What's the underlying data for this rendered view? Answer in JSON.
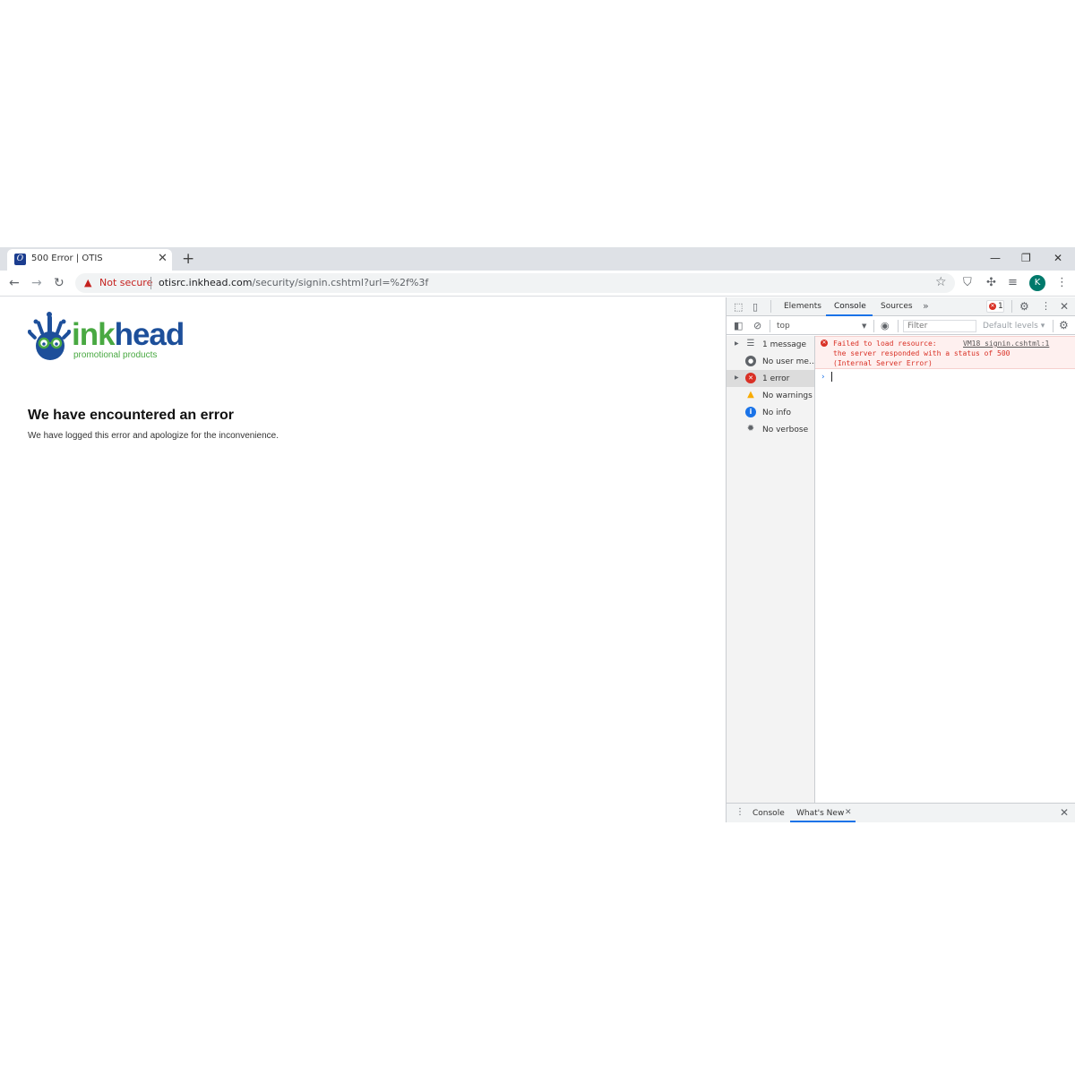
{
  "browser": {
    "tab_title": "500 Error | OTIS",
    "tab_close": "✕",
    "new_tab": "+",
    "window_controls": {
      "minimize": "—",
      "restore": "❐",
      "close": "✕"
    }
  },
  "toolbar": {
    "security_label": "Not secure",
    "url_host": "otisrc.inkhead.com",
    "url_path": "/security/signin.cshtml?url=%2f%3f",
    "profile_initial": "K"
  },
  "page": {
    "logo": {
      "ink": "ink",
      "head": "head",
      "tagline": "promotional products"
    },
    "error_title": "We have encountered an error",
    "error_text": "We have logged this error and apologize for the inconvenience."
  },
  "devtools": {
    "tabs": [
      "Elements",
      "Console",
      "Sources"
    ],
    "active_tab": "Console",
    "error_count": "1",
    "context": "top",
    "filter_placeholder": "Filter",
    "levels": "Default levels ▾",
    "sidebar": [
      {
        "label": "1 message",
        "icon": "list-icon",
        "expandable": true
      },
      {
        "label": "No user me…",
        "icon": "user-icon",
        "expandable": false
      },
      {
        "label": "1 error",
        "icon": "error-icon",
        "expandable": true,
        "selected": true
      },
      {
        "label": "No warnings",
        "icon": "warning-icon",
        "expandable": false
      },
      {
        "label": "No info",
        "icon": "info-icon",
        "expandable": false
      },
      {
        "label": "No verbose",
        "icon": "bug-icon",
        "expandable": false
      }
    ],
    "console_error": {
      "line1": "Failed to load resource:",
      "line2": "the server responded with a status of 500",
      "line3": "(Internal Server Error)",
      "source": "VM18 signin.cshtml:1"
    },
    "drawer_tabs": [
      "Console",
      "What's New"
    ]
  },
  "colors": {
    "error_red": "#d93025",
    "accent_blue": "#1a73e8",
    "logo_green": "#49a942",
    "logo_blue": "#1d4f9a"
  }
}
